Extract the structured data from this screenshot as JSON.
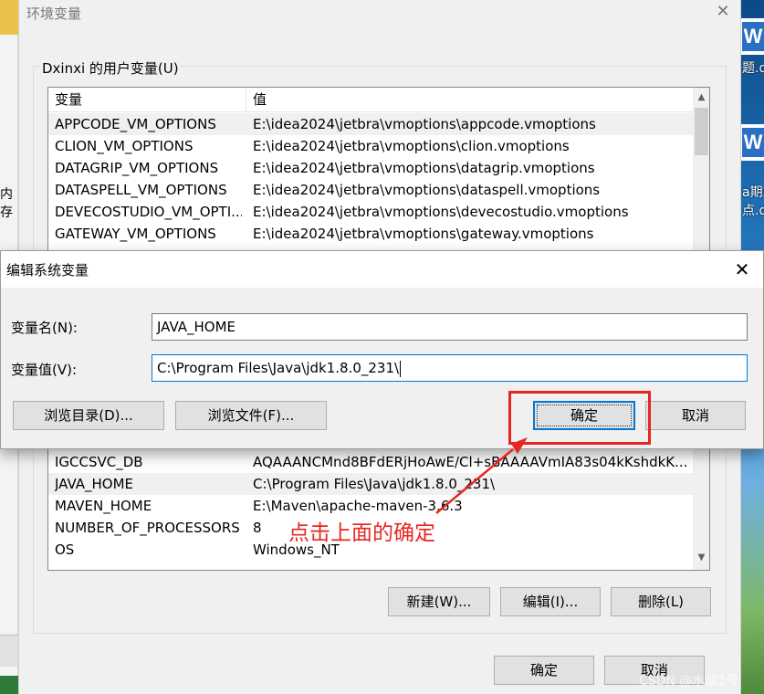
{
  "main_dialog": {
    "title": "环境变量",
    "close_glyph": "✕",
    "user_vars_group_label": "Dxinxi 的用户变量(U)",
    "columns": [
      "变量",
      "值"
    ],
    "rows_top": [
      {
        "name": "APPCODE_VM_OPTIONS",
        "value": "E:\\idea2024\\jetbra\\vmoptions\\appcode.vmoptions"
      },
      {
        "name": "CLION_VM_OPTIONS",
        "value": "E:\\idea2024\\jetbra\\vmoptions\\clion.vmoptions"
      },
      {
        "name": "DATAGRIP_VM_OPTIONS",
        "value": "E:\\idea2024\\jetbra\\vmoptions\\datagrip.vmoptions"
      },
      {
        "name": "DATASPELL_VM_OPTIONS",
        "value": "E:\\idea2024\\jetbra\\vmoptions\\dataspell.vmoptions"
      },
      {
        "name": "DEVECOSTUDIO_VM_OPTI...",
        "value": "E:\\idea2024\\jetbra\\vmoptions\\devecostudio.vmoptions"
      },
      {
        "name": "GATEWAY_VM_OPTIONS",
        "value": "E:\\idea2024\\jetbra\\vmoptions\\gateway.vmoptions"
      }
    ],
    "rows_bottom": [
      {
        "name": "IGCCSVC_DB",
        "value": "AQAAANCMnd8BFdERjHoAwE/Cl+sBAAAAVmIA83s04kKshdkK..."
      },
      {
        "name": "JAVA_HOME",
        "value": "C:\\Program Files\\Java\\jdk1.8.0_231\\"
      },
      {
        "name": "MAVEN_HOME",
        "value": "E:\\Maven\\apache-maven-3.6.3"
      },
      {
        "name": "NUMBER_OF_PROCESSORS",
        "value": "8"
      },
      {
        "name": "OS",
        "value": "Windows_NT"
      }
    ],
    "buttons": {
      "new": "新建(W)...",
      "edit": "编辑(I)...",
      "delete": "删除(L)"
    },
    "footer": {
      "ok": "确定",
      "cancel": "取消"
    }
  },
  "edit_dialog": {
    "title": "编辑系统变量",
    "close_glyph": "✕",
    "name_label": "变量名(N):",
    "name_value": "JAVA_HOME",
    "value_label": "变量值(V):",
    "value_value": "C:\\Program Files\\Java\\jdk1.8.0_231\\",
    "browse_dir": "浏览目录(D)...",
    "browse_file": "浏览文件(F)...",
    "ok": "确定",
    "cancel": "取消"
  },
  "annotation": {
    "text": "点击上面的确定",
    "color": "#e8261f"
  },
  "desktop": {
    "left_text": "内存",
    "right_texts": [
      "题.do",
      "a期末",
      "点.d"
    ],
    "word_icon": "W"
  },
  "watermark": "CSDN @水或1号",
  "colors": {
    "accent": "#0078d7",
    "annotation_red": "#e8261f"
  }
}
